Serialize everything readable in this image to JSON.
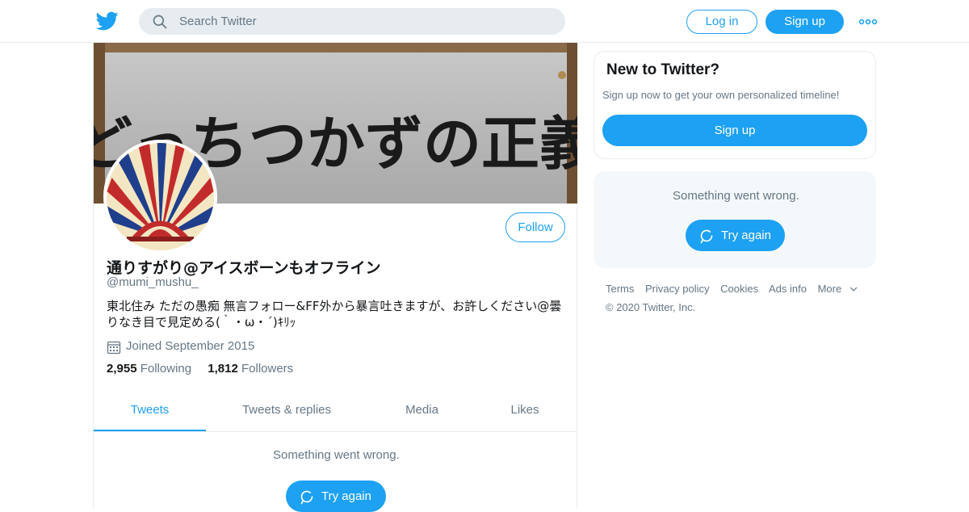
{
  "header": {
    "search_placeholder": "Search Twitter",
    "login_label": "Log in",
    "signup_label": "Sign up"
  },
  "profile": {
    "banner_text": "どっちつかずの正義",
    "display_name": "通りすがり@アイスボーンもオフライン",
    "handle": "@mumi_mushu_",
    "bio": "東北住み ただの愚痴 無言フォロー&FF外から暴言吐きますが、お許しください@曇りなき目で見定める(｀・ω・´)ｷﾘｯ",
    "joined": "Joined September 2015",
    "following_count": "2,955",
    "following_label": "Following",
    "followers_count": "1,812",
    "followers_label": "Followers",
    "follow_label": "Follow"
  },
  "tabs": [
    {
      "label": "Tweets",
      "active": true
    },
    {
      "label": "Tweets & replies",
      "active": false
    },
    {
      "label": "Media",
      "active": false
    },
    {
      "label": "Likes",
      "active": false
    }
  ],
  "timeline": {
    "error_text": "Something went wrong.",
    "retry_label": "Try again"
  },
  "sidebar": {
    "new_title": "New to Twitter?",
    "new_subtitle": "Sign up now to get your own personalized timeline!",
    "signup_label": "Sign up",
    "error_text": "Something went wrong.",
    "retry_label": "Try again"
  },
  "footer": {
    "links": [
      "Terms",
      "Privacy policy",
      "Cookies",
      "Ads info",
      "More"
    ],
    "copyright": "© 2020 Twitter, Inc."
  },
  "colors": {
    "brand": "#1da1f2",
    "text_secondary": "#657786",
    "border": "#e6ecf0"
  },
  "icons": [
    "twitter-logo-icon",
    "search-icon",
    "more-dots-icon",
    "calendar-icon",
    "refresh-icon",
    "chevron-down-icon"
  ]
}
